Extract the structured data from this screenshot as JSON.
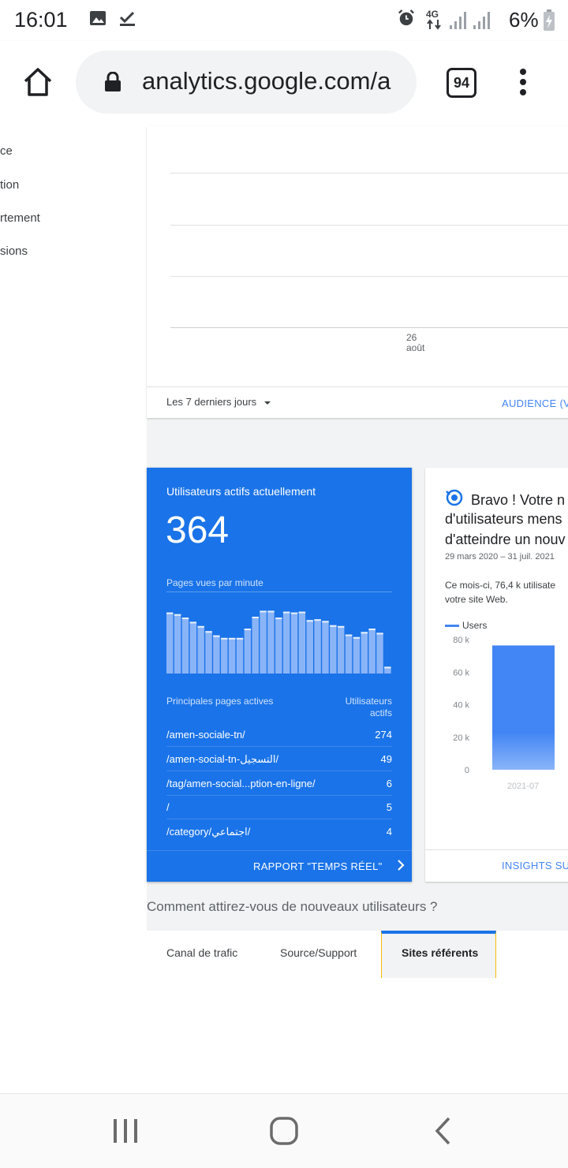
{
  "status": {
    "time": "16:01",
    "network": "4G",
    "battery": "6%"
  },
  "browser": {
    "url": "analytics.google.com/a",
    "tab_count": "94"
  },
  "sidebar": {
    "items": [
      "ce",
      "tion",
      "rtement",
      "sions"
    ]
  },
  "overview": {
    "x_tick_day": "26",
    "x_tick_month": "août",
    "range_selector": "Les 7 derniers jours",
    "audience_link": "AUDIENCE (V"
  },
  "realtime": {
    "title": "Utilisateurs actifs actuellement",
    "active_users": "364",
    "pageviews_label": "Pages vues par minute",
    "pageviews_per_minute": [
      72,
      70,
      66,
      61,
      56,
      50,
      45,
      42,
      42,
      42,
      53,
      67,
      74,
      74,
      66,
      73,
      72,
      73,
      63,
      64,
      62,
      57,
      56,
      46,
      43,
      49,
      53,
      48,
      8
    ],
    "table_header_pages": "Principales pages actives",
    "table_header_users_1": "Utilisateurs",
    "table_header_users_2": "actifs",
    "rows": [
      {
        "page": "/amen-sociale-tn/",
        "users": "274"
      },
      {
        "page": "/amen-social-tn-التسجيل/",
        "users": "49"
      },
      {
        "page": "/tag/amen-social...ption-en-ligne/",
        "users": "6"
      },
      {
        "page": "/",
        "users": "5"
      },
      {
        "page": "/category/اجتماعي/",
        "users": "4"
      }
    ],
    "report_link": "RAPPORT \"TEMPS RÉEL\""
  },
  "insight": {
    "title_line1": "Bravo ! Votre n",
    "title_line2": "d'utilisateurs mens",
    "title_line3": "d'atteindre un nouv",
    "date_range": "29 mars 2020 – 31 juil. 2021",
    "desc_line1": "Ce mois-ci, 76,4 k utilisate",
    "desc_line2": "votre site Web.",
    "link": "INSIGHTS SUR"
  },
  "chart_data": {
    "type": "bar",
    "categories": [
      "2021-07"
    ],
    "series": [
      {
        "name": "Users",
        "values": [
          76400
        ]
      }
    ],
    "yticks": [
      "80 k",
      "60 k",
      "40 k",
      "20 k",
      "0"
    ],
    "ylim": [
      0,
      80000
    ]
  },
  "acquisition": {
    "title": "Comment attirez-vous de nouveaux utilisateurs ?",
    "tabs": [
      "Canal de trafic",
      "Source/Support",
      "Sites référents"
    ]
  },
  "colors": {
    "accent": "#1a73e8",
    "link": "#4285f4",
    "bar": "#4285f4"
  }
}
